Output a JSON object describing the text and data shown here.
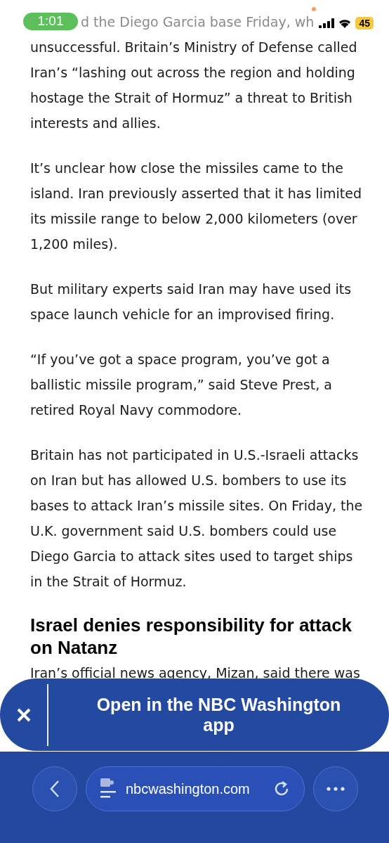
{
  "status_bar": {
    "time": "1:01",
    "battery": "45"
  },
  "article": {
    "blocks": [
      {
        "kind": "paragraph",
        "text": "d the Diego Garcia base Friday, wh",
        "faded": true
      },
      {
        "kind": "paragraph",
        "text": "unsuccessful. Britain’s Ministry of Defense called Iran’s “lashing out across the region and holding hostage the Strait of Hormuz” a threat to British interests and allies.",
        "faded": false
      },
      {
        "kind": "paragraph",
        "text": "It’s unclear how close the missiles came to the island. Iran previously asserted that it has limited its missile range to below 2,000 kilometers (over 1,200 miles).",
        "faded": false
      },
      {
        "kind": "paragraph",
        "text": "But military experts said Iran may have used its space launch vehicle for an improvised firing.",
        "faded": false
      },
      {
        "kind": "paragraph",
        "text": "“If you’ve got a space program, you’ve got a ballistic missile program,” said Steve Prest, a retired Royal Navy commodore.",
        "faded": false
      },
      {
        "kind": "paragraph",
        "text": "Britain has not participated in U.S.-Israeli attacks on Iran but has allowed U.S. bombers to use its bases to attack Iran’s missile sites. On Friday, the U.K. government said U.S. bombers could use Diego Garcia to attack sites used to target ships in the Strait of Hormuz.",
        "faded": false
      },
      {
        "kind": "heading",
        "text": "Israel denies responsibility for attack on Natanz"
      },
      {
        "kind": "paragraph",
        "text": "Iran’s official news agency, Mizan, said there was",
        "faded": false
      }
    ]
  },
  "app_banner": {
    "text": "Open in the NBC Washington app"
  },
  "browser_bar": {
    "url": "nbcwashington.com"
  }
}
